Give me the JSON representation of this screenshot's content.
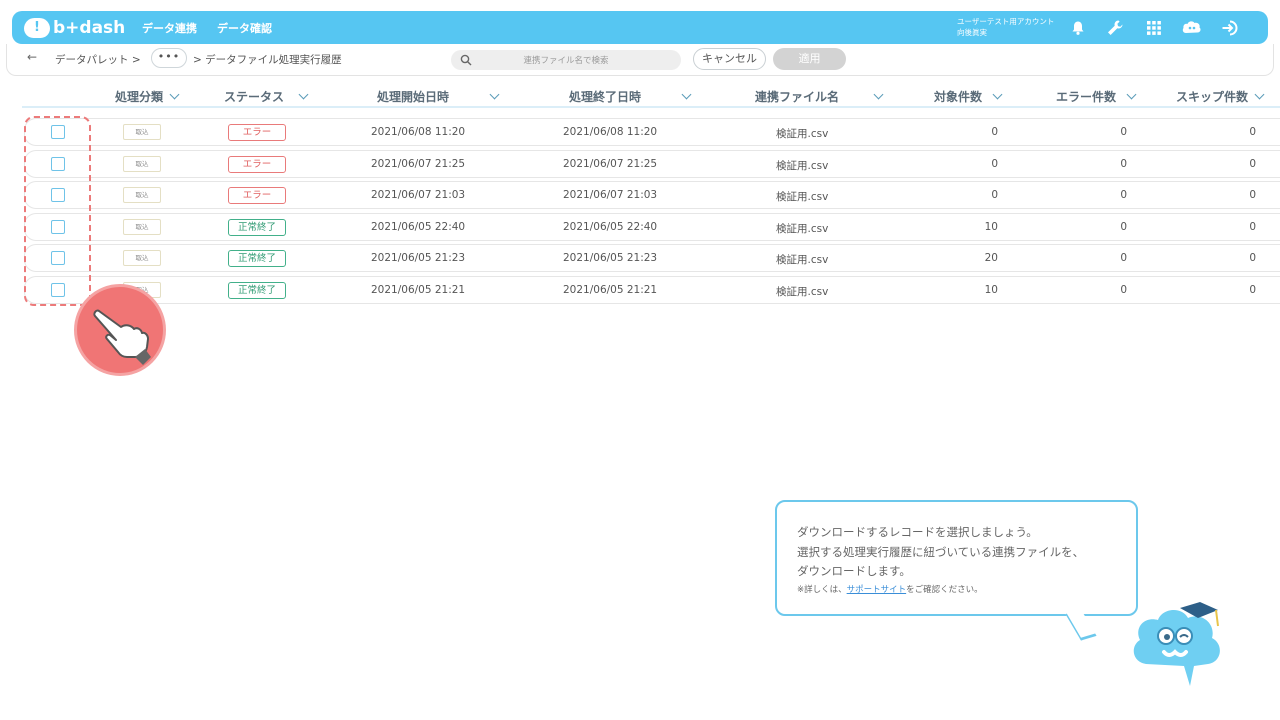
{
  "header": {
    "logo_text": "b+dash",
    "logo_mark": "!",
    "nav": [
      "データ連携",
      "データ確認"
    ],
    "account_line1": "ユーザーテスト用アカウント",
    "account_line2": "向後眞実",
    "icons": [
      "bell-icon",
      "wrench-icon",
      "grid-icon",
      "mascot-icon",
      "logout-icon"
    ]
  },
  "toolbar": {
    "back_arrow": "←",
    "crumb1": "データパレット >",
    "dots": "•••",
    "crumb2": "> データファイル処理実行履歴",
    "search_placeholder": "連携ファイル名で検索",
    "cancel_label": "キャンセル",
    "apply_label": "適用"
  },
  "table": {
    "columns": [
      "処理分類",
      "ステータス",
      "処理開始日時",
      "処理終了日時",
      "連携ファイル名",
      "対象件数",
      "エラー件数",
      "スキップ件数"
    ],
    "rows": [
      {
        "category": "取込",
        "status": "エラー",
        "status_type": "err",
        "start": "2021/06/08 11:20",
        "end": "2021/06/08 11:20",
        "file": "検証用.csv",
        "target": "0",
        "errors": "0",
        "skips": "0"
      },
      {
        "category": "取込",
        "status": "エラー",
        "status_type": "err",
        "start": "2021/06/07 21:25",
        "end": "2021/06/07 21:25",
        "file": "検証用.csv",
        "target": "0",
        "errors": "0",
        "skips": "0"
      },
      {
        "category": "取込",
        "status": "エラー",
        "status_type": "err",
        "start": "2021/06/07 21:03",
        "end": "2021/06/07 21:03",
        "file": "検証用.csv",
        "target": "0",
        "errors": "0",
        "skips": "0"
      },
      {
        "category": "取込",
        "status": "正常終了",
        "status_type": "ok",
        "start": "2021/06/05 22:40",
        "end": "2021/06/05 22:40",
        "file": "検証用.csv",
        "target": "10",
        "errors": "0",
        "skips": "0"
      },
      {
        "category": "取込",
        "status": "正常終了",
        "status_type": "ok",
        "start": "2021/06/05 21:23",
        "end": "2021/06/05 21:23",
        "file": "検証用.csv",
        "target": "20",
        "errors": "0",
        "skips": "0"
      },
      {
        "category": "取込",
        "status": "正常終了",
        "status_type": "ok",
        "start": "2021/06/05 21:21",
        "end": "2021/06/05 21:21",
        "file": "検証用.csv",
        "target": "10",
        "errors": "0",
        "skips": "0"
      }
    ]
  },
  "tooltip": {
    "line1": "ダウンロードするレコードを選択しましょう。",
    "line2": "選択する処理実行履歴に紐づいている連携ファイルを、",
    "line3": "ダウンロードします。",
    "note_prefix": "※詳しくは、",
    "note_link": "サポートサイト",
    "note_suffix": "をご確認ください。"
  },
  "colors": {
    "brand": "#56c6f2",
    "error": "#e97a7a",
    "success": "#42b08a",
    "highlight": "#ec7a7a"
  }
}
